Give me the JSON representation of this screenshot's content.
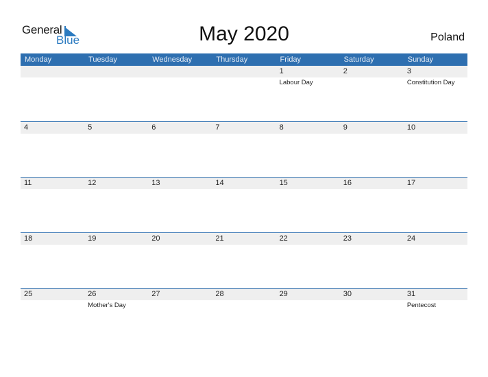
{
  "logo": {
    "part1": "General",
    "part2": "Blue",
    "accent": "#2a7ac0"
  },
  "title": "May 2020",
  "country": "Poland",
  "colors": {
    "header_bg": "#2e6fb0",
    "date_strip": "#efefef"
  },
  "weekdays": [
    "Monday",
    "Tuesday",
    "Wednesday",
    "Thursday",
    "Friday",
    "Saturday",
    "Sunday"
  ],
  "weeks": [
    [
      {
        "day": "",
        "holiday": ""
      },
      {
        "day": "",
        "holiday": ""
      },
      {
        "day": "",
        "holiday": ""
      },
      {
        "day": "",
        "holiday": ""
      },
      {
        "day": "1",
        "holiday": "Labour Day"
      },
      {
        "day": "2",
        "holiday": ""
      },
      {
        "day": "3",
        "holiday": "Constitution Day"
      }
    ],
    [
      {
        "day": "4",
        "holiday": ""
      },
      {
        "day": "5",
        "holiday": ""
      },
      {
        "day": "6",
        "holiday": ""
      },
      {
        "day": "7",
        "holiday": ""
      },
      {
        "day": "8",
        "holiday": ""
      },
      {
        "day": "9",
        "holiday": ""
      },
      {
        "day": "10",
        "holiday": ""
      }
    ],
    [
      {
        "day": "11",
        "holiday": ""
      },
      {
        "day": "12",
        "holiday": ""
      },
      {
        "day": "13",
        "holiday": ""
      },
      {
        "day": "14",
        "holiday": ""
      },
      {
        "day": "15",
        "holiday": ""
      },
      {
        "day": "16",
        "holiday": ""
      },
      {
        "day": "17",
        "holiday": ""
      }
    ],
    [
      {
        "day": "18",
        "holiday": ""
      },
      {
        "day": "19",
        "holiday": ""
      },
      {
        "day": "20",
        "holiday": ""
      },
      {
        "day": "21",
        "holiday": ""
      },
      {
        "day": "22",
        "holiday": ""
      },
      {
        "day": "23",
        "holiday": ""
      },
      {
        "day": "24",
        "holiday": ""
      }
    ],
    [
      {
        "day": "25",
        "holiday": ""
      },
      {
        "day": "26",
        "holiday": "Mother's Day"
      },
      {
        "day": "27",
        "holiday": ""
      },
      {
        "day": "28",
        "holiday": ""
      },
      {
        "day": "29",
        "holiday": ""
      },
      {
        "day": "30",
        "holiday": ""
      },
      {
        "day": "31",
        "holiday": "Pentecost"
      }
    ]
  ]
}
